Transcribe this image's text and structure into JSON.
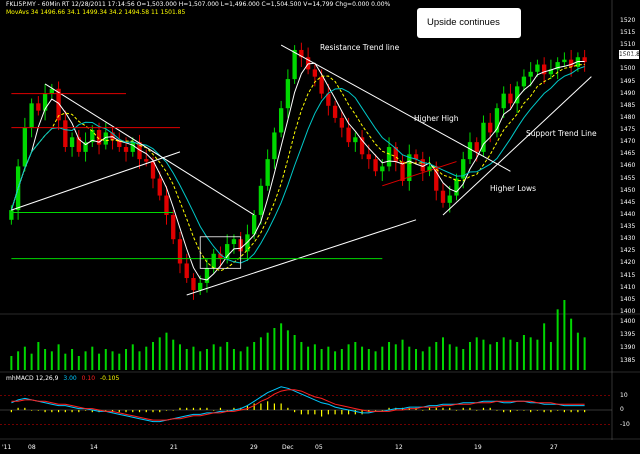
{
  "header": {
    "line1": "FKLI5P.MY - 60Min RT  12/28/2011  17:14:56   O=1,503.000  H=1,507.000  L=1,496.000  C=1,504.500  V=14,799  Chg=0.000  0.00%",
    "line2": "MovAvs 34  1496.66  34.1  1499.34  34.2  1494.58  11  1501.85"
  },
  "macd_label": {
    "name": "mhMACD 12,26,9",
    "v1": "3.00",
    "v2": "0.10",
    "v3": "-0.105"
  },
  "annotations": {
    "upside": "Upside continues",
    "resistance": "Resistance Trend line",
    "higher_high": "Higher High",
    "support": "Support Trend Line",
    "higher_lows": "Higher Lows"
  },
  "last_price": "1501.85",
  "colors": {
    "up": "#00d800",
    "down": "#e00000",
    "ma1": "#ffffff",
    "ma2": "#ffff00",
    "ma3": "#00c8c8",
    "volume": "#00d800",
    "macd": "#00c8ff",
    "signal": "#ff2020",
    "histogram": "#ffff00",
    "trendline": "#ffffff",
    "resistance_line": "#e00000",
    "support_line": "#00d800"
  },
  "chart_data": {
    "type": "candlestick",
    "y_axis": {
      "labels": [
        "1520",
        "1515",
        "1510",
        "1505",
        "1500",
        "1495",
        "1490",
        "1485",
        "1480",
        "1475",
        "1470",
        "1465",
        "1460",
        "1455",
        "1450",
        "1445",
        "1440",
        "1435",
        "1430",
        "1425",
        "1420",
        "1415",
        "1410",
        "1405",
        "1400"
      ],
      "ylim": [
        1400,
        1522
      ]
    },
    "volume_axis": {
      "labels": [
        "1400",
        "1395",
        "1390",
        "1385"
      ]
    },
    "macd_axis": {
      "labels": [
        "10",
        "0",
        "-10"
      ]
    },
    "x_axis": {
      "labels": [
        "'11",
        "08",
        "14",
        "21",
        "29",
        "Dec",
        "05",
        "12",
        "19",
        "27"
      ]
    },
    "closes": [
      1442,
      1460,
      1476,
      1486,
      1483,
      1490,
      1492,
      1479,
      1468,
      1472,
      1466,
      1470,
      1475,
      1469,
      1474,
      1471,
      1468,
      1466,
      1470,
      1463,
      1462,
      1455,
      1448,
      1440,
      1430,
      1420,
      1414,
      1409,
      1412,
      1418,
      1424,
      1422,
      1428,
      1430,
      1425,
      1432,
      1440,
      1452,
      1463,
      1474,
      1484,
      1496,
      1508,
      1505,
      1500,
      1497,
      1490,
      1485,
      1480,
      1476,
      1470,
      1472,
      1465,
      1463,
      1458,
      1460,
      1468,
      1462,
      1454,
      1465,
      1463,
      1458,
      1460,
      1450,
      1445,
      1448,
      1455,
      1463,
      1470,
      1466,
      1478,
      1474,
      1484,
      1490,
      1486,
      1493,
      1497,
      1499,
      1502,
      1498,
      1500,
      1503,
      1504,
      1501,
      1505,
      1503
    ],
    "volume": [
      6,
      8,
      10,
      7,
      12,
      9,
      8,
      11,
      7,
      9,
      6,
      8,
      10,
      7,
      9,
      8,
      7,
      9,
      11,
      8,
      10,
      12,
      14,
      16,
      13,
      11,
      9,
      10,
      8,
      9,
      11,
      10,
      12,
      9,
      8,
      10,
      12,
      14,
      16,
      18,
      20,
      17,
      15,
      12,
      10,
      11,
      9,
      10,
      8,
      9,
      11,
      12,
      10,
      9,
      8,
      10,
      12,
      11,
      13,
      10,
      9,
      8,
      10,
      12,
      14,
      11,
      10,
      9,
      12,
      14,
      13,
      11,
      12,
      14,
      13,
      12,
      15,
      14,
      13,
      20,
      12,
      26,
      30,
      22,
      16,
      14
    ],
    "macd": [
      5,
      7,
      8,
      7,
      6,
      5,
      4,
      3,
      3,
      2,
      1,
      1,
      0,
      -1,
      -1,
      -2,
      -3,
      -4,
      -5,
      -6,
      -7,
      -8,
      -8,
      -7,
      -6,
      -5,
      -4,
      -3,
      -3,
      -2,
      -2,
      -1,
      -1,
      0,
      1,
      3,
      6,
      9,
      12,
      14,
      16,
      15,
      13,
      11,
      9,
      7,
      5,
      4,
      2,
      1,
      0,
      -1,
      -2,
      -2,
      -1,
      -1,
      0,
      1,
      1,
      2,
      2,
      2,
      3,
      3,
      4,
      4,
      4,
      5,
      5,
      5,
      6,
      6,
      6,
      5,
      5,
      6,
      6,
      5,
      5,
      4,
      4,
      4,
      3,
      3,
      3,
      3
    ],
    "signal": [
      6,
      6,
      7,
      7,
      6,
      6,
      5,
      4,
      4,
      3,
      2,
      1,
      1,
      0,
      -1,
      -1,
      -2,
      -3,
      -4,
      -5,
      -6,
      -7,
      -7,
      -7,
      -6,
      -6,
      -5,
      -4,
      -4,
      -3,
      -2,
      -2,
      -1,
      -1,
      0,
      1,
      3,
      6,
      8,
      11,
      13,
      14,
      14,
      13,
      11,
      9,
      8,
      6,
      4,
      3,
      2,
      1,
      0,
      -1,
      -1,
      -1,
      -1,
      0,
      0,
      1,
      1,
      2,
      2,
      2,
      3,
      3,
      4,
      4,
      4,
      5,
      5,
      5,
      6,
      6,
      6,
      6,
      6,
      6,
      5,
      5,
      5,
      4,
      4,
      4,
      4,
      4
    ]
  }
}
